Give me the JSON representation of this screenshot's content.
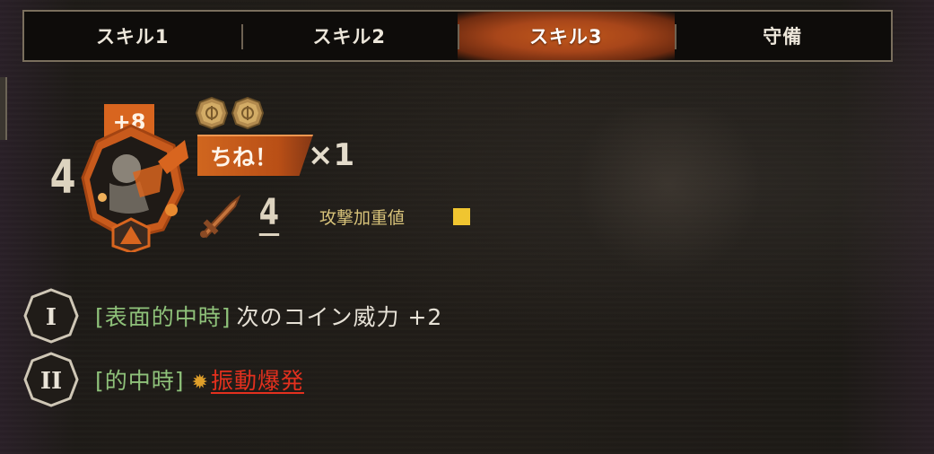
{
  "tabs": [
    {
      "label": "スキル1",
      "active": false
    },
    {
      "label": "スキル2",
      "active": false
    },
    {
      "label": "スキル3",
      "active": true
    },
    {
      "label": "守備",
      "active": false
    }
  ],
  "skill": {
    "coin_power": "4",
    "bonus": "+8",
    "coin_icons": [
      "coin-icon",
      "coin-icon"
    ],
    "name": "ちね！",
    "multiplier": "×1",
    "attack_level": "4",
    "attack_weight_label": "攻撃加重値",
    "attack_weight_color": "#f0c530"
  },
  "effects": [
    {
      "badge": "I",
      "condition": "[表面的中時]",
      "description": "次のコイン威力 +2",
      "keyword": ""
    },
    {
      "badge": "II",
      "condition": "[的中時]",
      "description": "",
      "keyword": "振動爆発",
      "keyword_icon": "burst-icon"
    }
  ],
  "colors": {
    "accent": "#c0571b",
    "condition_green": "#8fc27a",
    "keyword_red": "#e3301e"
  }
}
